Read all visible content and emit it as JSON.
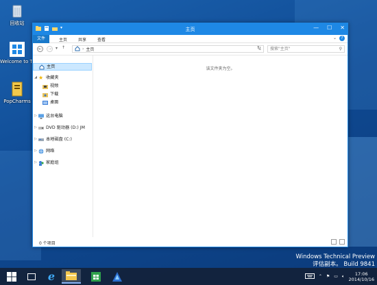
{
  "desktop": {
    "icons": [
      {
        "label": "回收站",
        "icon": "recycle-bin-icon"
      },
      {
        "label": "Welcome to Tech Previ...",
        "icon": "welcome-icon"
      },
      {
        "label": "PopCharms",
        "icon": "popcharms-icon"
      }
    ],
    "watermark": {
      "line1": "Windows Technical Preview",
      "line2": "评估副本。 Build 9841"
    }
  },
  "explorer": {
    "title": "主页",
    "ribbon_tabs": [
      {
        "label": "文件",
        "active": true
      },
      {
        "label": "主页",
        "active": false
      },
      {
        "label": "共享",
        "active": false
      },
      {
        "label": "查看",
        "active": false
      }
    ],
    "help_label": "?",
    "address": {
      "path": "主页"
    },
    "search_placeholder": "搜索\"主页\"",
    "nav": {
      "home": "主页",
      "favorites": "收藏夹",
      "videos": "视频",
      "downloads": "下载",
      "desktop": "桌面",
      "this_pc": "这台电脑",
      "dvd": "DVD 驱动器 (D:) JM",
      "local_disk": "本地磁盘 (C:)",
      "network": "网络",
      "homegroup": "家庭组"
    },
    "empty_message": "该文件夹为空。",
    "status": "0 个项目"
  },
  "taskbar": {
    "time": "17:06",
    "date": "2014/10/16"
  }
}
